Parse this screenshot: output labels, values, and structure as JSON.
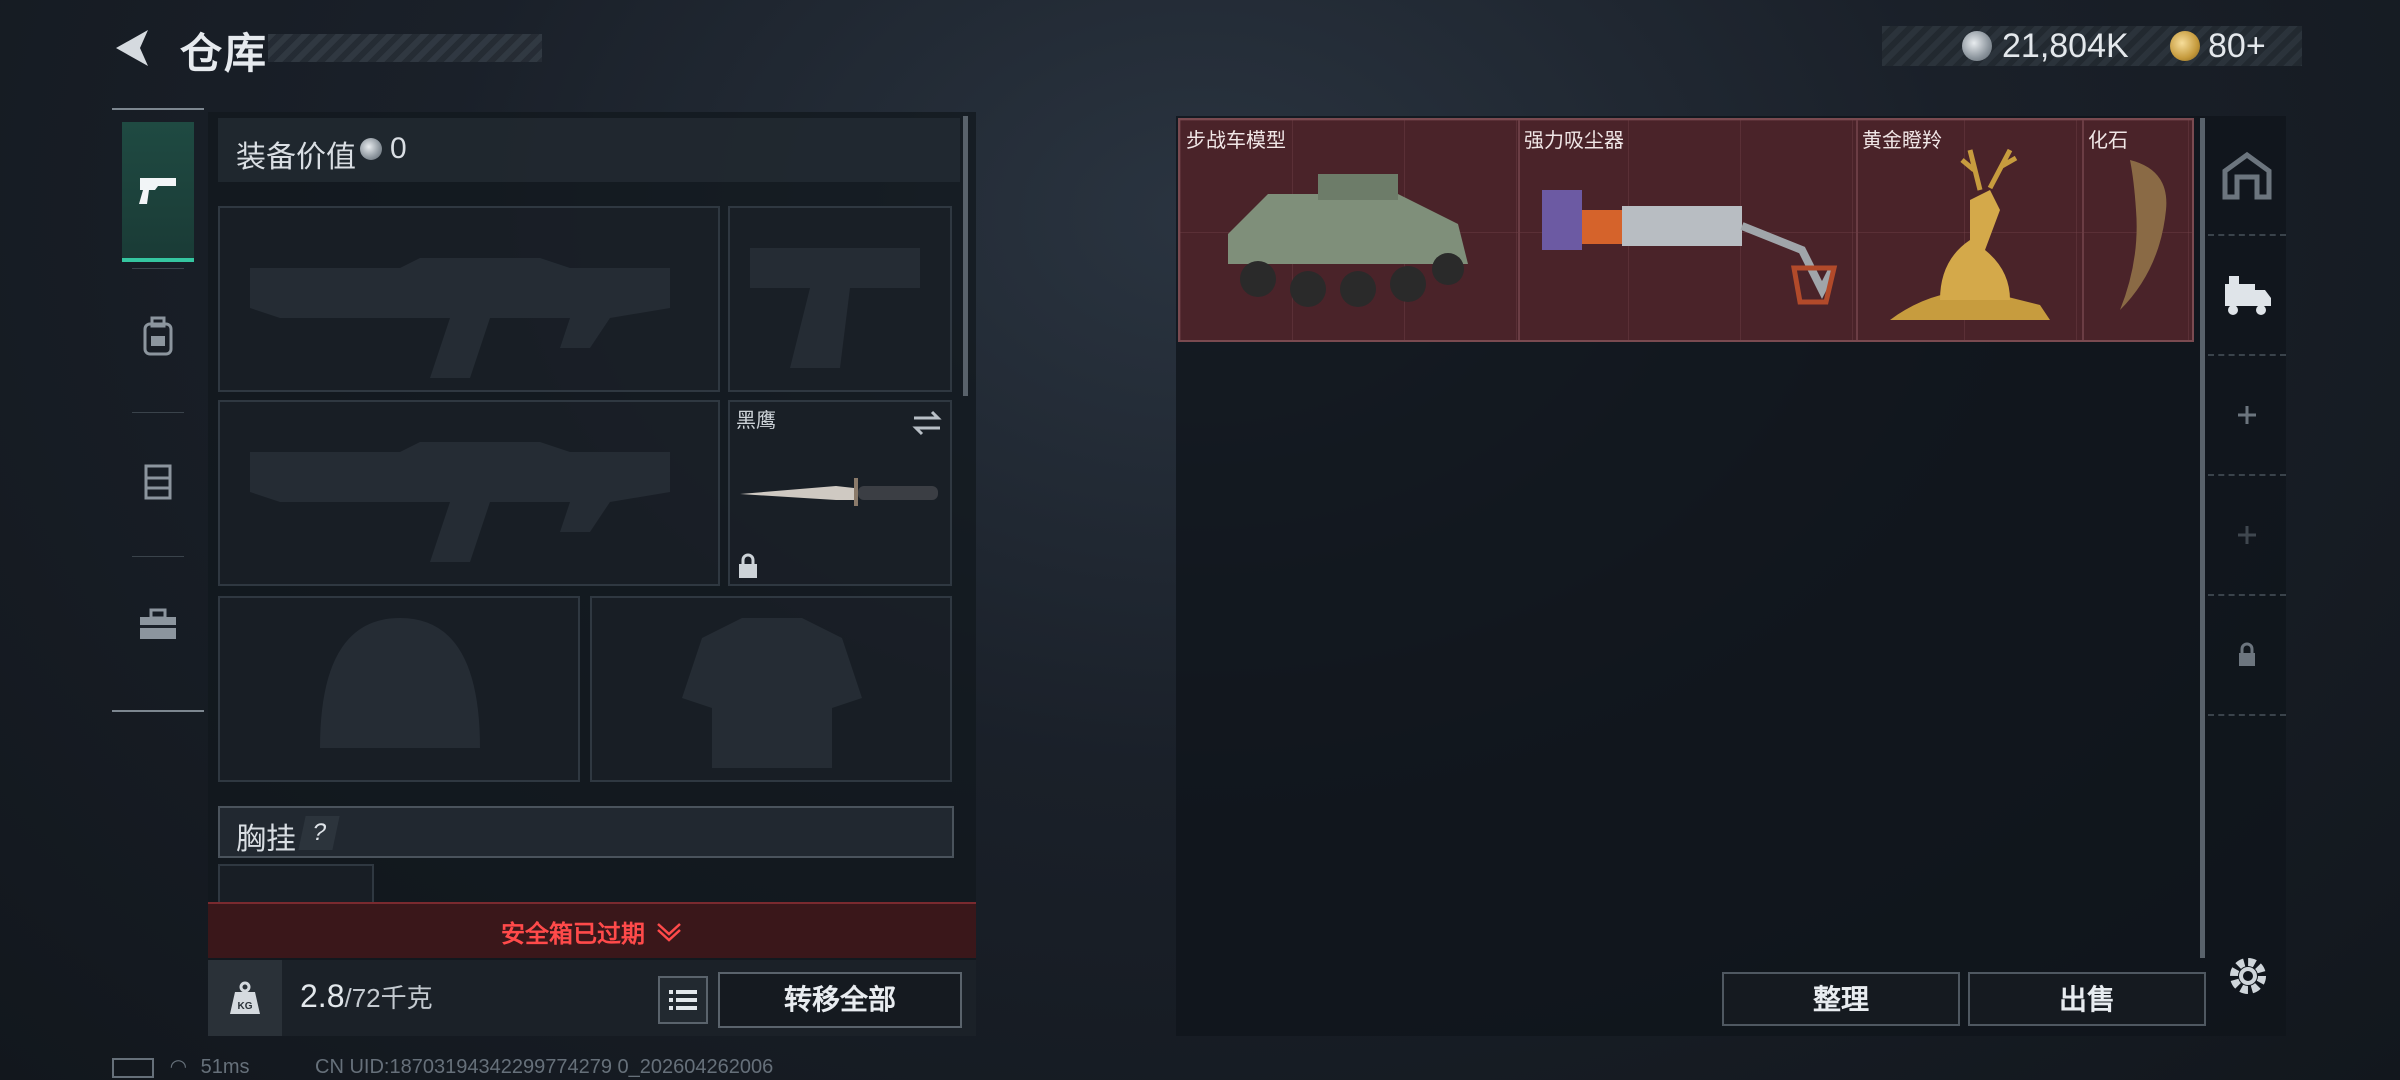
{
  "header": {
    "title": "仓库"
  },
  "currency": {
    "silver": "21,804K",
    "gold": "80+"
  },
  "loadout": {
    "value_label": "装备价值",
    "value": "0",
    "knife_label": "黑鹰",
    "chest_rig_label": "胸挂",
    "chest_rig_help": "?",
    "safe_box_expired": "安全箱已过期"
  },
  "bottom": {
    "weight": "2.8",
    "weight_max": "/72千克",
    "transfer_all": "转移全部"
  },
  "stash": {
    "items": [
      {
        "name": "步战车模型"
      },
      {
        "name": "强力吸尘器"
      },
      {
        "name": "黄金瞪羚"
      },
      {
        "name": "化石"
      }
    ],
    "sort_label": "整理",
    "sell_label": "出售"
  },
  "status": {
    "ping": "51ms",
    "uid": "CN UID:18703194342299774279 0_202604262006"
  },
  "colors": {
    "accent": "#35c6a0",
    "item_bg": "#4a2329",
    "expired": "#ff4a4a"
  },
  "icons": {
    "nav": [
      "pistol-icon",
      "backpack-icon",
      "vest-icon",
      "toolbox-icon"
    ],
    "right_sidebar": [
      "stash-icon",
      "truck-icon",
      "add-icon",
      "add-icon",
      "lock-icon"
    ]
  }
}
